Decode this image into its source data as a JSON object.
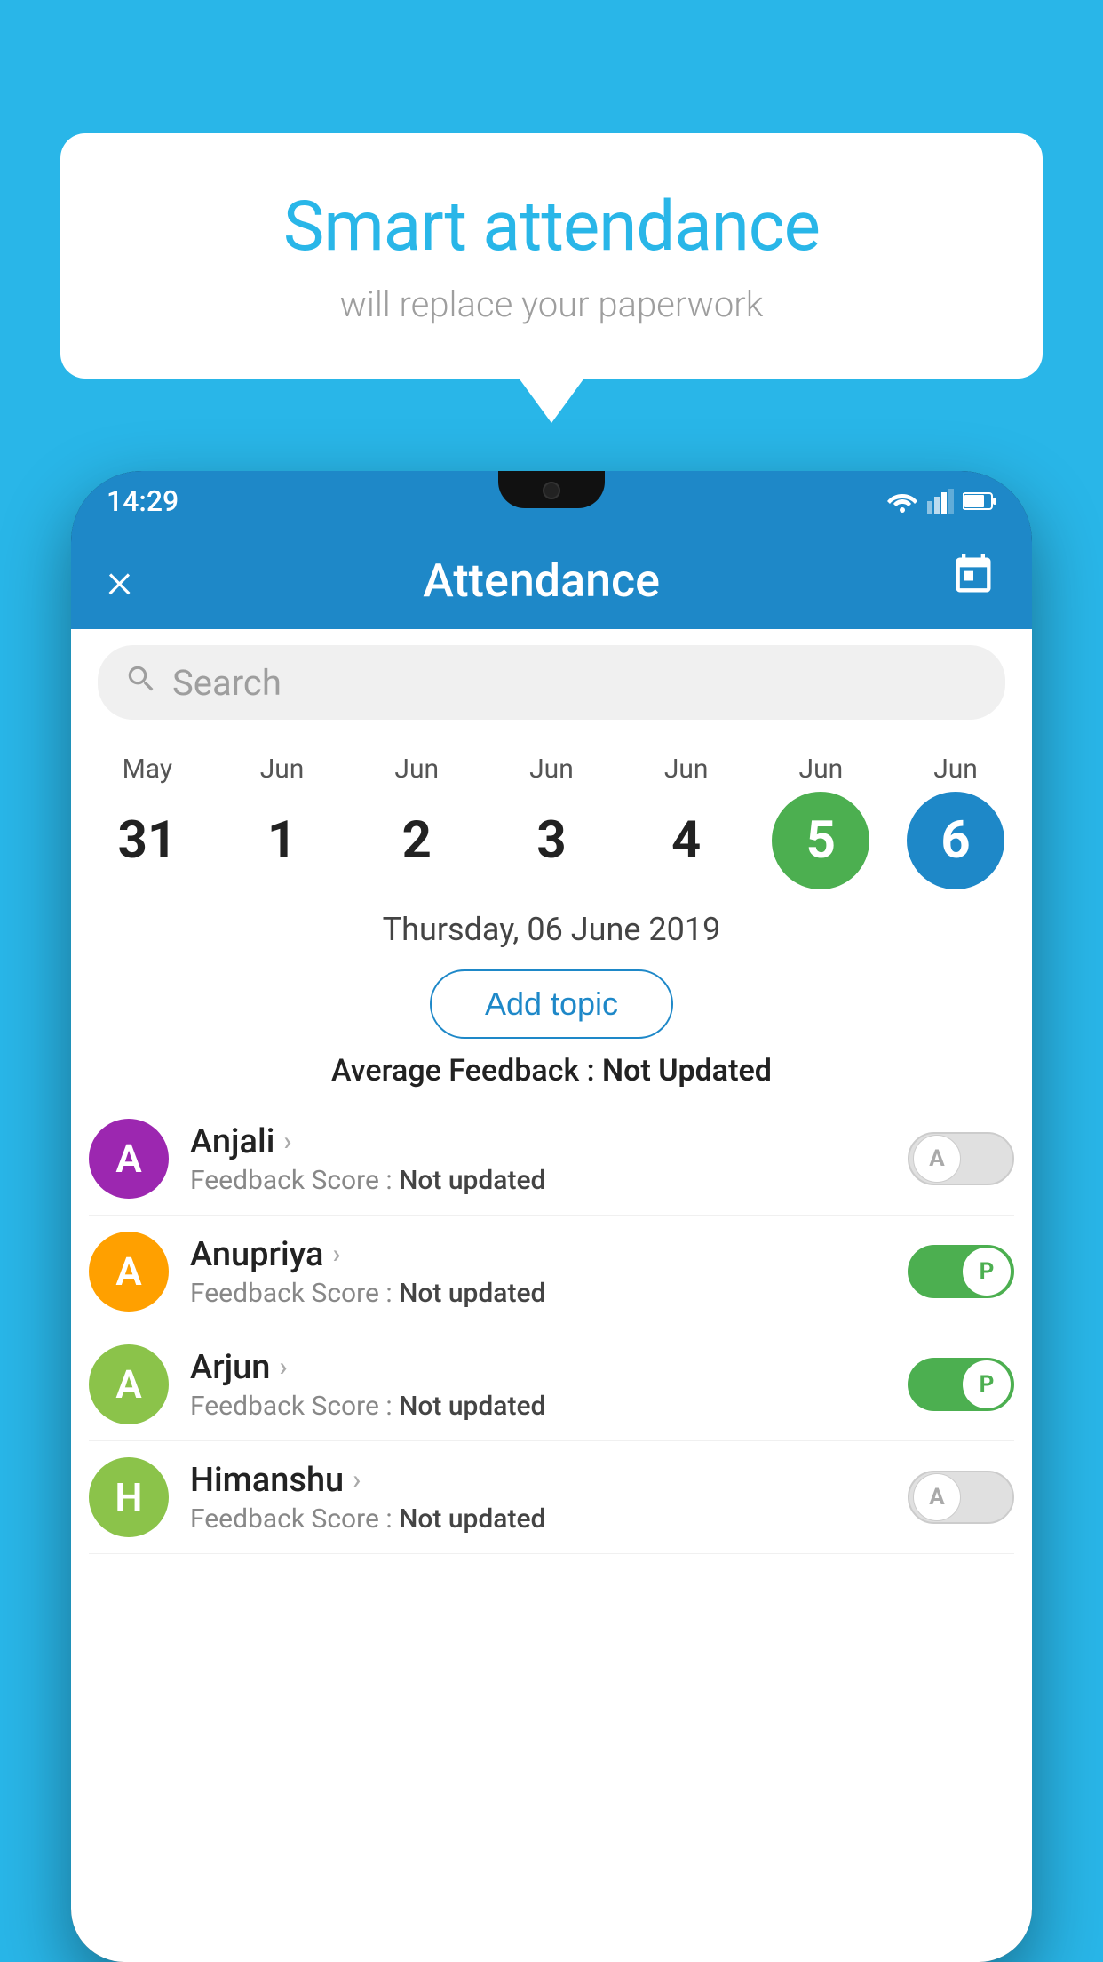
{
  "background_color": "#29b6e8",
  "speech_bubble": {
    "title": "Smart attendance",
    "subtitle": "will replace your paperwork"
  },
  "status_bar": {
    "time": "14:29"
  },
  "app_bar": {
    "title": "Attendance",
    "close_label": "×",
    "calendar_label": "📅"
  },
  "search": {
    "placeholder": "Search"
  },
  "calendar": {
    "days": [
      {
        "month": "May",
        "date": "31",
        "style": "normal"
      },
      {
        "month": "Jun",
        "date": "1",
        "style": "normal"
      },
      {
        "month": "Jun",
        "date": "2",
        "style": "normal"
      },
      {
        "month": "Jun",
        "date": "3",
        "style": "normal"
      },
      {
        "month": "Jun",
        "date": "4",
        "style": "normal"
      },
      {
        "month": "Jun",
        "date": "5",
        "style": "today"
      },
      {
        "month": "Jun",
        "date": "6",
        "style": "selected"
      }
    ]
  },
  "selected_date": "Thursday, 06 June 2019",
  "add_topic_label": "Add topic",
  "average_feedback": {
    "label": "Average Feedback : ",
    "value": "Not Updated"
  },
  "students": [
    {
      "name": "Anjali",
      "avatar_letter": "A",
      "avatar_color": "#9c27b0",
      "feedback_label": "Feedback Score : ",
      "feedback_value": "Not updated",
      "attendance": "absent",
      "toggle_label": "A"
    },
    {
      "name": "Anupriya",
      "avatar_letter": "A",
      "avatar_color": "#ffa000",
      "feedback_label": "Feedback Score : ",
      "feedback_value": "Not updated",
      "attendance": "present",
      "toggle_label": "P"
    },
    {
      "name": "Arjun",
      "avatar_letter": "A",
      "avatar_color": "#8bc34a",
      "feedback_label": "Feedback Score : ",
      "feedback_value": "Not updated",
      "attendance": "present",
      "toggle_label": "P"
    },
    {
      "name": "Himanshu",
      "avatar_letter": "H",
      "avatar_color": "#8bc34a",
      "feedback_label": "Feedback Score : ",
      "feedback_value": "Not updated",
      "attendance": "absent",
      "toggle_label": "A"
    }
  ]
}
